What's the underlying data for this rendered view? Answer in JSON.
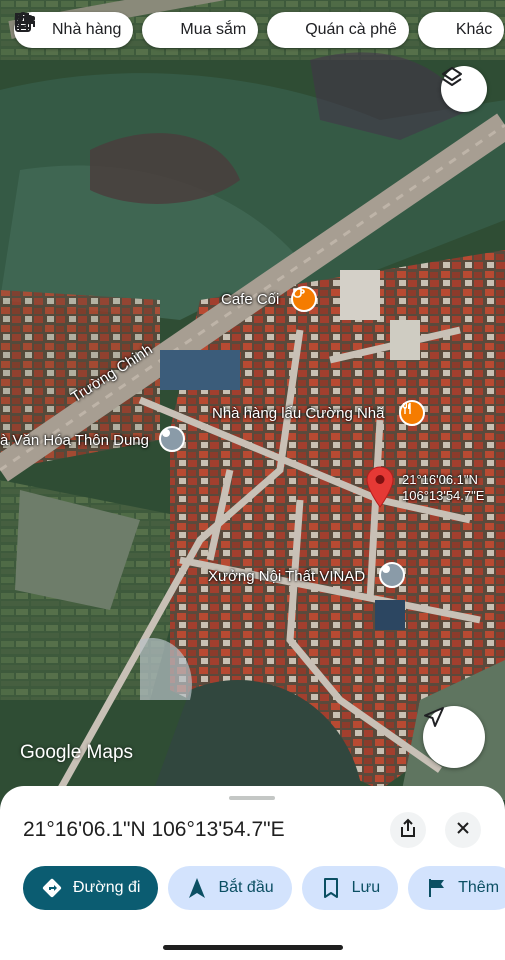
{
  "chips": [
    {
      "label": "Nhà hàng",
      "icon": "fork-knife-icon"
    },
    {
      "label": "Mua sắm",
      "icon": "shopping-bag-icon"
    },
    {
      "label": "Quán cà phê",
      "icon": "coffee-cup-icon"
    },
    {
      "label": "Khác",
      "icon": "bed-icon"
    }
  ],
  "map": {
    "streets": {
      "truong_chinh": "Trường Chinh"
    },
    "places": {
      "cafe": "Cafe Cối",
      "restaurant": "Nhà hàng lẩu Cường Nhã",
      "culture_house": "à Văn Hóa Thôn Dung",
      "workshop": "Xưởng Nội Thất VINAD"
    },
    "pin_coords": {
      "lat": "21°16'06.1\"N",
      "lng": "106°13'54.7\"E"
    },
    "attribution": "Google Maps",
    "colors": {
      "pin": "#e53935",
      "food_poi": "#f57c00",
      "generic_poi": "#8a9ba8"
    }
  },
  "sheet": {
    "title": "21°16'06.1\"N 106°13'54.7\"E",
    "actions": [
      {
        "label": "Đường đi",
        "icon": "directions-icon"
      },
      {
        "label": "Bắt đầu",
        "icon": "navigation-arrow-icon"
      },
      {
        "label": "Lưu",
        "icon": "bookmark-icon"
      },
      {
        "label": "Thêm",
        "icon": "flag-icon"
      }
    ],
    "colors": {
      "primary": "#0b5c71",
      "secondary": "#d3e3fd"
    }
  }
}
